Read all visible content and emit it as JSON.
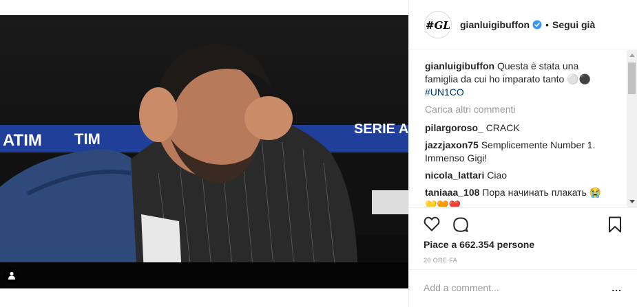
{
  "post": {
    "username": "gianluigibuffon",
    "follow_status": "Segui già",
    "dot": "•",
    "avatar_logo": "#GL",
    "verified": true
  },
  "photo": {
    "banner_left": "ATIM",
    "banner_mid": "TIM",
    "banner_right": "SERIE A"
  },
  "caption": {
    "username": "gianluigibuffon",
    "text": "Questa è stata una famiglia da cui ho imparato tanto ⚪⚫",
    "hashtag": "#UN1CO"
  },
  "load_more": "Carica altri commenti",
  "comments": [
    {
      "user": "pilargoroso_",
      "text": "CRACK"
    },
    {
      "user": "jazzjaxon75",
      "text": "Semplicemente Number 1. Immenso Gigi!"
    },
    {
      "user": "nicola_lattari",
      "text": "Ciao"
    },
    {
      "user": "taniaaa_108",
      "text": "Пора начинать плакать 😭💛🧡❤️"
    }
  ],
  "likes_text": "Piace a 662.354 persone",
  "time_ago": "20 ORE FA",
  "add_comment_placeholder": "Add a comment...",
  "more_label": "...",
  "icons": {
    "like": "heart-icon",
    "comment": "comment-icon",
    "bookmark": "bookmark-icon",
    "user_tag": "user-tag-icon",
    "verified": "verified-badge-icon"
  },
  "colors": {
    "verified": "#3897f0",
    "hashtag": "#003569",
    "muted": "#999999",
    "text": "#262626"
  }
}
